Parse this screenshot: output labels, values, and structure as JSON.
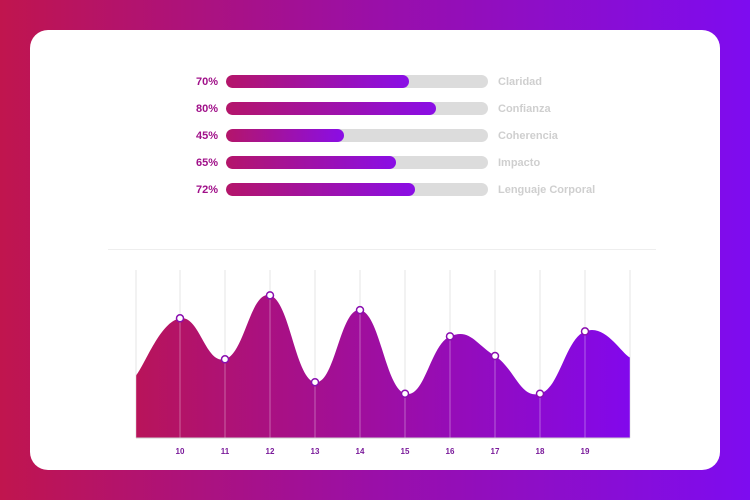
{
  "colors": {
    "accent_start": "#c0154e",
    "accent_end": "#7e0cf0",
    "track": "#dcdcdc",
    "label": "#cfcfcf"
  },
  "skills": [
    {
      "pct_label": "70%",
      "value": 70,
      "label": "Claridad"
    },
    {
      "pct_label": "80%",
      "value": 80,
      "label": "Confianza"
    },
    {
      "pct_label": "45%",
      "value": 45,
      "label": "Coherencia"
    },
    {
      "pct_label": "65%",
      "value": 65,
      "label": "Impacto"
    },
    {
      "pct_label": "72%",
      "value": 72,
      "label": "Lenguaje Corporal"
    }
  ],
  "chart_data": {
    "type": "area",
    "x": [
      10,
      11,
      12,
      13,
      14,
      15,
      16,
      17,
      18,
      19
    ],
    "values": [
      73,
      48,
      87,
      34,
      78,
      27,
      62,
      50,
      27,
      65
    ],
    "start_value": 38,
    "end_value": 49,
    "ylim": [
      0,
      100
    ],
    "grid": true,
    "title": "",
    "xlabel": "",
    "ylabel": ""
  }
}
